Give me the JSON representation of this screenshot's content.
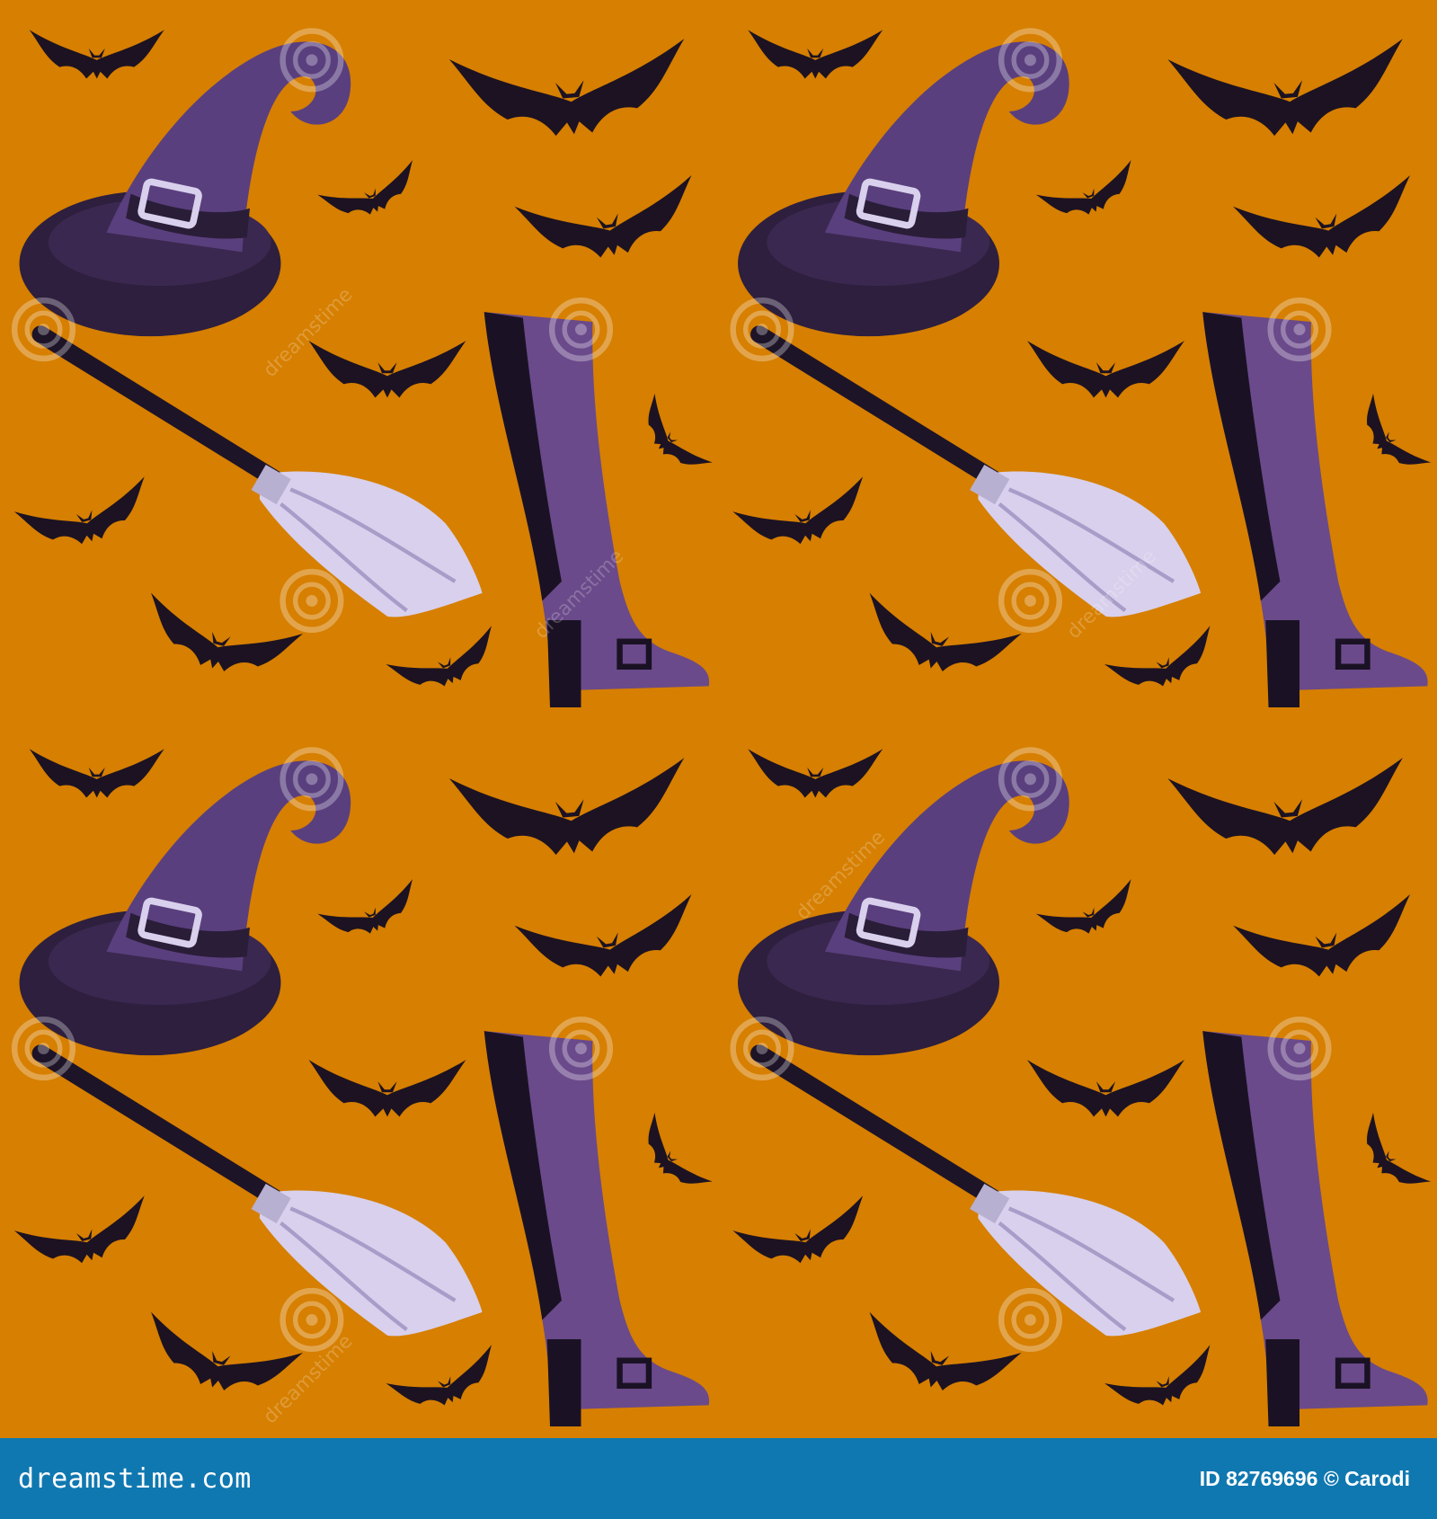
{
  "image": {
    "watermark_text": "dreamstime",
    "background_color": "#d67f00",
    "footer_color": "#1078b0"
  },
  "footer": {
    "logo": "dreamstime.com",
    "credit": "ID 82769696 © Carodi"
  }
}
